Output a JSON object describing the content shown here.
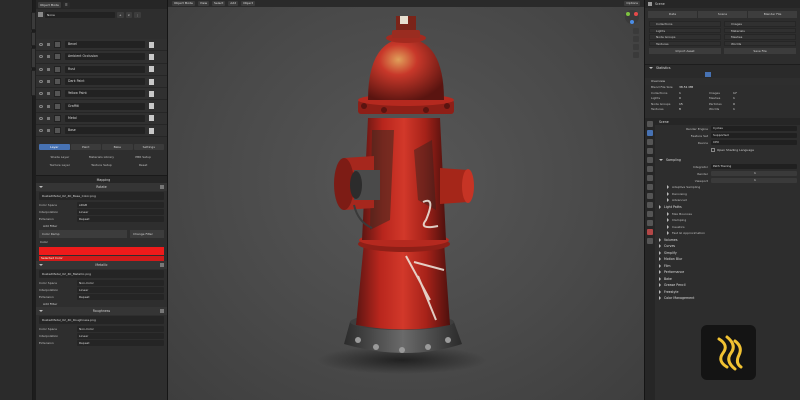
{
  "app": {
    "accent": "#4772b3"
  },
  "left_panel": {
    "header": {
      "mode": "Object Mode",
      "layer_set": "None"
    },
    "layers": [
      {
        "name": "Bevel",
        "value": ""
      },
      {
        "name": "Ambient Occlusion",
        "value": ""
      },
      {
        "name": "Rust",
        "value": ""
      },
      {
        "name": "Dark Paint",
        "value": ""
      },
      {
        "name": "Yellow Paint",
        "value": ""
      },
      {
        "name": "Graffiti",
        "value": ""
      },
      {
        "name": "Metal",
        "value": ""
      },
      {
        "name": "Base",
        "value": ""
      }
    ],
    "tabs": [
      {
        "label": "Layer",
        "active": true
      },
      {
        "label": "Paint"
      },
      {
        "label": "Bake"
      },
      {
        "label": "Settings"
      }
    ],
    "buttons": [
      "Shade Layer",
      "Materials Library",
      "PBR Setup",
      "Texture Layer",
      "Texture Setup",
      "Reset"
    ],
    "mapping_section": "Mapping",
    "nodes": [
      {
        "title": "Rotate",
        "file": "RustedMetal_02_4K_Base_Color.png",
        "props": [
          {
            "k": "Color Space",
            "v": "sRGB"
          },
          {
            "k": "Interpolation",
            "v": "Linear"
          },
          {
            "k": "Extension",
            "v": "Repeat"
          }
        ],
        "filter_label": "Add Filter",
        "ramp": {
          "a": "Color Ramp",
          "b": "Change Filter"
        },
        "color_label": "Color",
        "red_label": "Selected Color"
      },
      {
        "title": "Metallic",
        "file": "RustedMetal_02_4K_Metallic.png",
        "props": [
          {
            "k": "Color Space",
            "v": "Non-Color"
          },
          {
            "k": "Interpolation",
            "v": "Linear"
          },
          {
            "k": "Extension",
            "v": "Repeat"
          }
        ],
        "filter_label": "Add Filter"
      },
      {
        "title": "Roughness",
        "file": "RustedMetal_02_4K_Roughness.png",
        "props": [
          {
            "k": "Color Space",
            "v": "Non-Color"
          },
          {
            "k": "Interpolation",
            "v": "Linear"
          },
          {
            "k": "Extension",
            "v": "Repeat"
          }
        ]
      }
    ]
  },
  "viewport": {
    "header": [
      "Object Mode",
      "View",
      "Select",
      "Add",
      "Object"
    ],
    "options": "Options"
  },
  "right_panel": {
    "header_title": "Scene",
    "tabs": [
      "Data",
      "Scene",
      "Blender File"
    ],
    "outliner": [
      [
        "Collections",
        "Images"
      ],
      [
        "Lights",
        "Materials"
      ],
      [
        "Node Groups",
        "Meshes"
      ],
      [
        "Textures",
        "Worlds"
      ]
    ],
    "buttons": [
      "Import Asset",
      "Save File"
    ],
    "stats_section": "Statistics",
    "stats_title": "Overview",
    "stats": [
      {
        "k1": "Blend File Size",
        "v1": "38.51 MB",
        "k2": "",
        "v2": ""
      },
      {
        "k1": "Collections",
        "v1": "1",
        "k2": "Images",
        "v2": "17"
      },
      {
        "k1": "Lights",
        "v1": "0",
        "k2": "Meshes",
        "v2": "1"
      },
      {
        "k1": "Node Groups",
        "v1": "15",
        "k2": "Particles",
        "v2": "0"
      },
      {
        "k1": "Textures",
        "v1": "8",
        "k2": "Worlds",
        "v2": "1"
      }
    ],
    "props_header": "Scene",
    "render": [
      {
        "k": "Render Engine",
        "v": "Cycles"
      },
      {
        "k": "Feature Set",
        "v": "Supported"
      },
      {
        "k": "Device",
        "v": "CPU"
      }
    ],
    "osl": "Open Shading Language",
    "sampling": "Sampling",
    "viewport_rows": [
      {
        "k": "Integrator",
        "v": "Path Tracing"
      },
      {
        "k": "Render",
        "v": "1"
      },
      {
        "k": "Viewport",
        "v": "1"
      }
    ],
    "subsections": [
      "Adaptive Sampling",
      "Denoising",
      "Advanced"
    ],
    "light_paths": "Light Paths",
    "light_sub": [
      "Max Bounces",
      "Clamping",
      "Caustics",
      "Fast GI Approximation"
    ],
    "more_sections": [
      "Volumes",
      "Curves",
      "Simplify",
      "Motion Blur",
      "Film",
      "Performance",
      "Bake",
      "Grease Pencil",
      "Freestyle",
      "Color Management"
    ]
  }
}
